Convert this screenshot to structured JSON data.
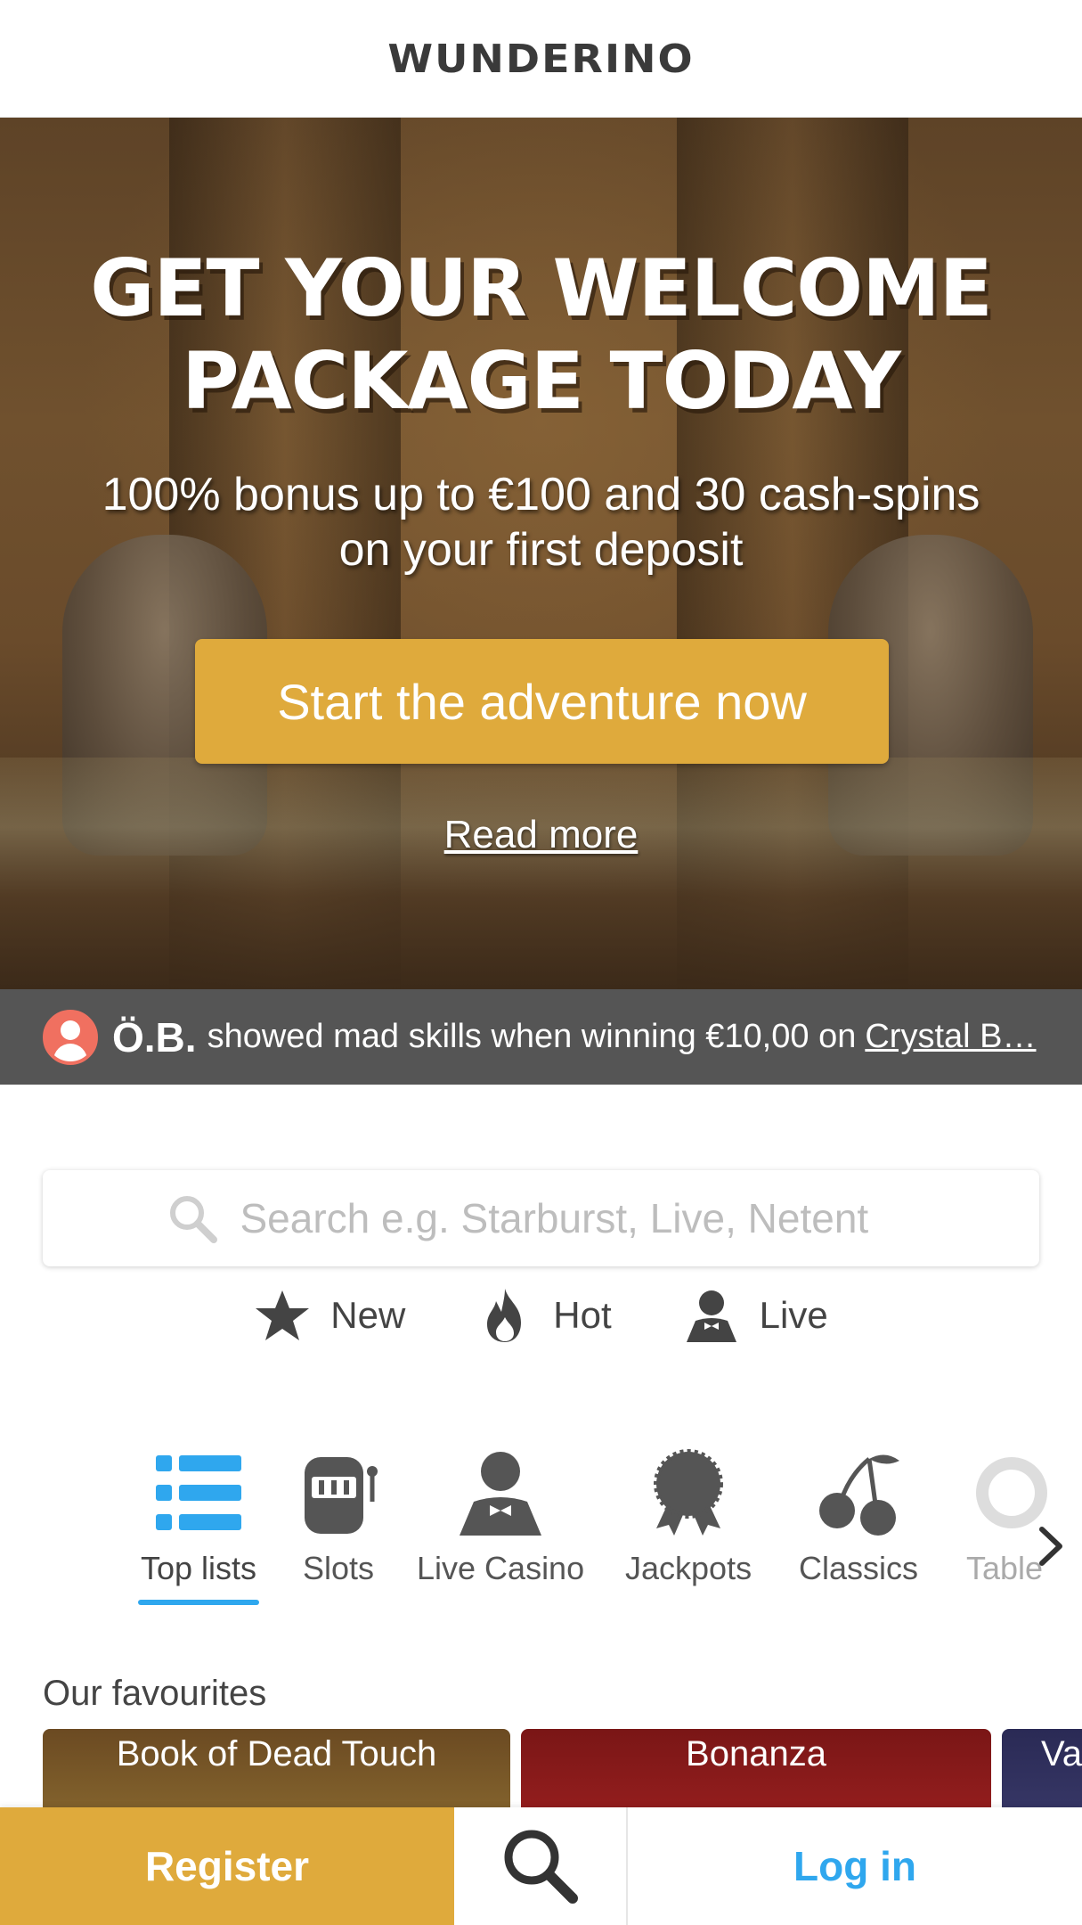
{
  "header": {
    "logo_text": "WUNDERINO"
  },
  "hero": {
    "title_line1": "GET YOUR WELCOME",
    "title_line2": "PACKAGE TODAY",
    "subtitle_line1": "100% bonus up to €100 and 30 cash-spins",
    "subtitle_line2": "on your first deposit",
    "cta_label": "Start the adventure now",
    "read_more_label": "Read more"
  },
  "ticker": {
    "winner": "Ö.B.",
    "message": "showed mad skills when winning €10,00 on",
    "game": "Crystal B…",
    "avatar_color": "#f07060"
  },
  "search": {
    "placeholder": "Search e.g. Starburst, Live, Netent"
  },
  "quick_filters": [
    {
      "label": "New",
      "icon": "star-icon"
    },
    {
      "label": "Hot",
      "icon": "flame-icon"
    },
    {
      "label": "Live",
      "icon": "dealer-icon"
    }
  ],
  "categories": [
    {
      "label": "Top lists",
      "icon": "list-icon",
      "active": true
    },
    {
      "label": "Slots",
      "icon": "slot-machine-icon"
    },
    {
      "label": "Live Casino",
      "icon": "dealer-icon"
    },
    {
      "label": "Jackpots",
      "icon": "medal-icon"
    },
    {
      "label": "Classics",
      "icon": "cherries-icon"
    },
    {
      "label": "Table",
      "icon": "chip-icon"
    }
  ],
  "favourites": {
    "title": "Our favourites",
    "tiles": [
      "Book of Dead Touch",
      "Bonanza",
      "Va"
    ]
  },
  "bottom_bar": {
    "register_label": "Register",
    "login_label": "Log in"
  },
  "colors": {
    "accent_gold": "#dfaa3c",
    "accent_blue": "#2fa7ee",
    "ticker_bg": "#555555"
  }
}
